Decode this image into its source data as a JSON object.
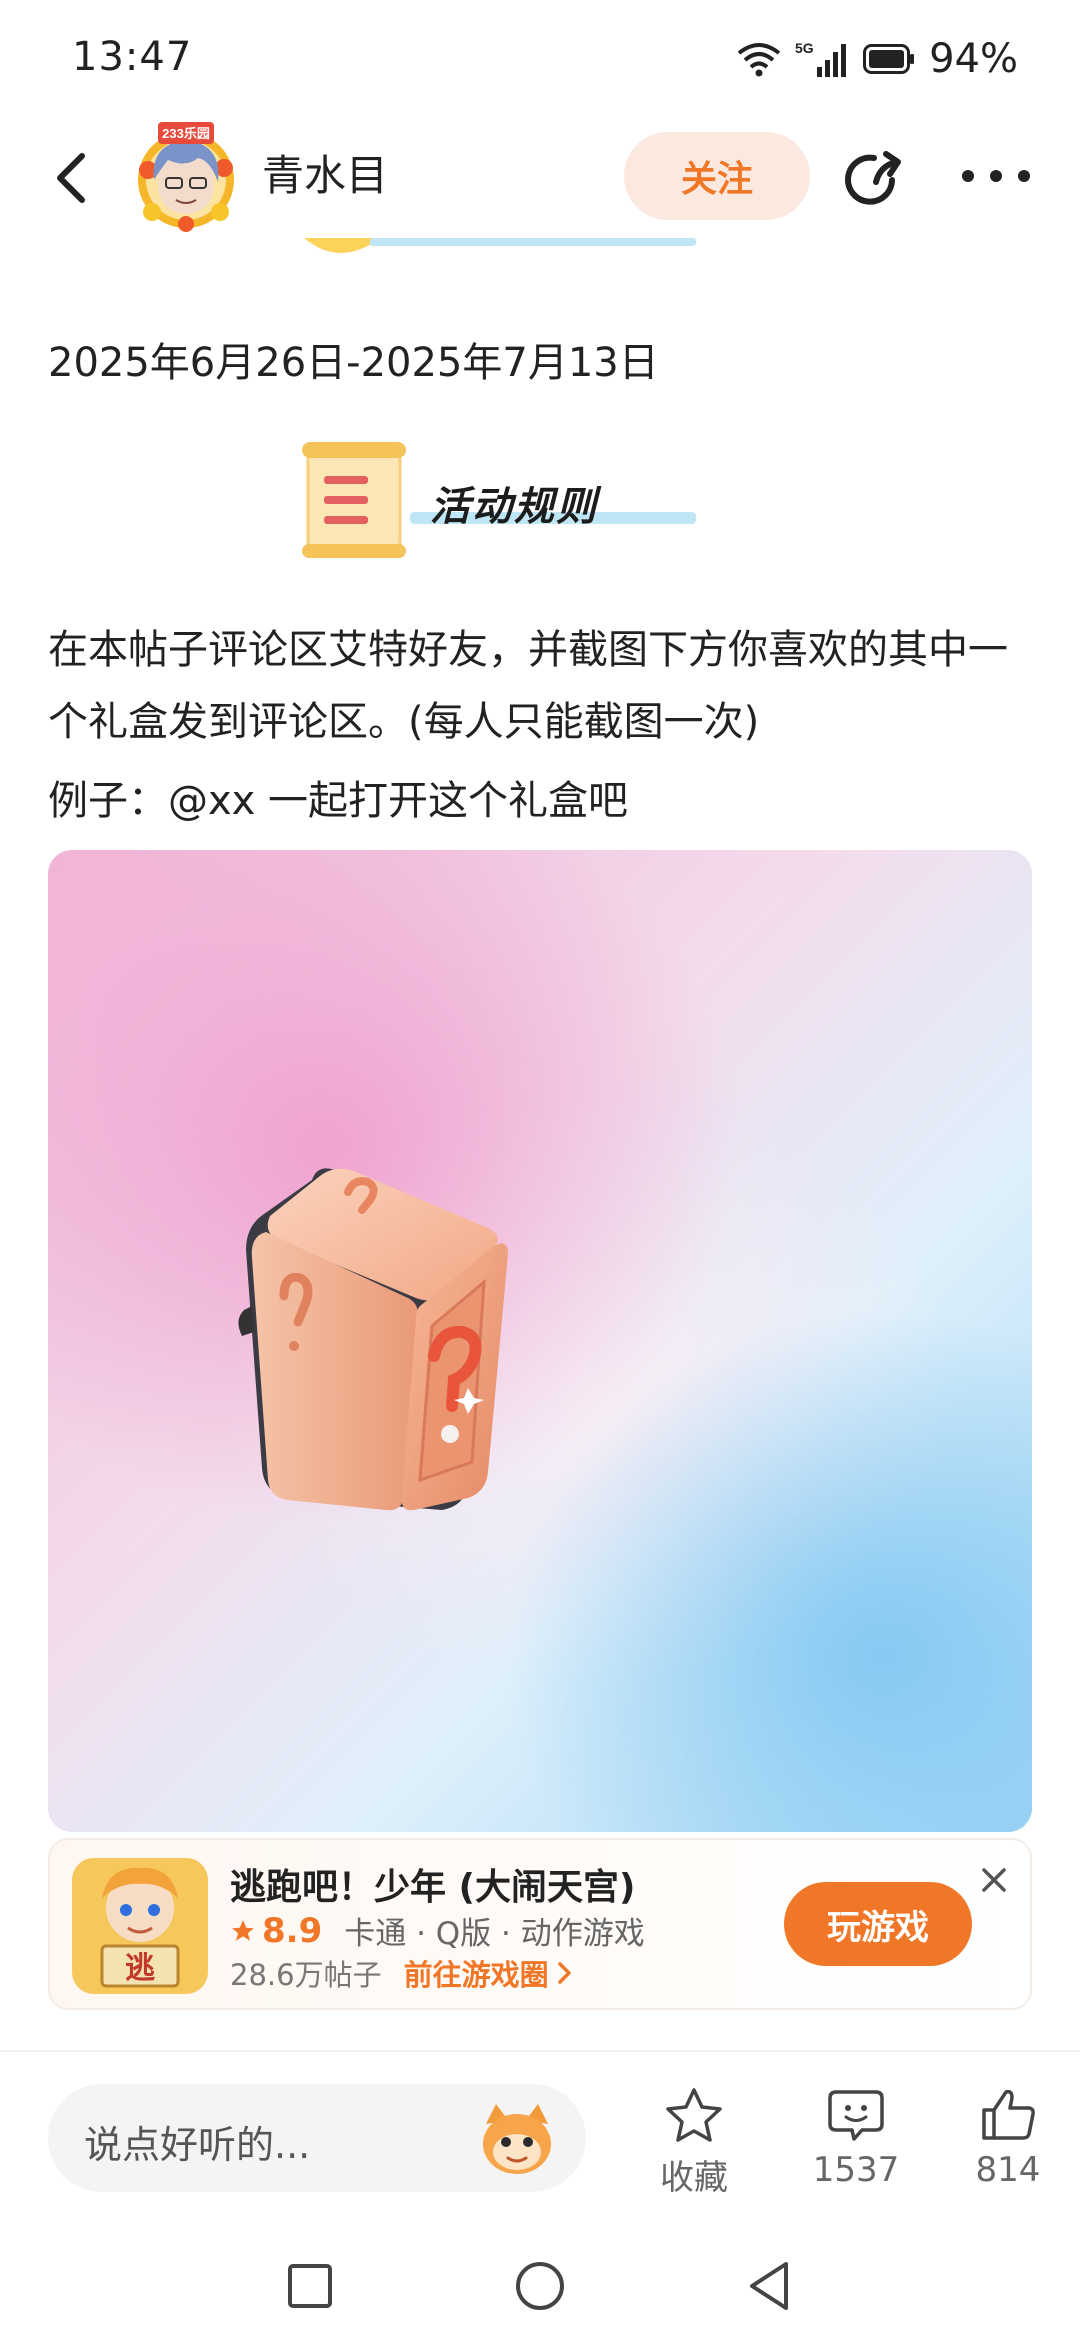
{
  "status_bar": {
    "time": "13:47",
    "network": "5G",
    "battery": "94%"
  },
  "header": {
    "author_name": "青水目",
    "avatar_badge": "233乐园",
    "follow_label": "关注"
  },
  "content": {
    "date_range": "2025年6月26日-2025年7月13日",
    "rules_title": "活动规则",
    "rules_text": "在本帖子评论区艾特好友，并截图下方你喜欢的其中一个礼盒发到评论区。(每人只能截图一次)",
    "example_text": "例子：@xx 一起打开这个礼盒吧"
  },
  "game_card": {
    "title": "逃跑吧！少年 (大闹天宫)",
    "score": "8.9",
    "tags": "卡通 · Q版 · 动作游戏",
    "posts": "28.6万帖子",
    "circle_link": "前往游戏圈",
    "play_label": "玩游戏",
    "icon_char": "逃"
  },
  "bottom_bar": {
    "comment_placeholder": "说点好听的...",
    "favorite_label": "收藏",
    "comment_count": "1537",
    "like_count": "814"
  },
  "colors": {
    "accent": "#f07727",
    "follow_bg": "#fbe9df"
  }
}
